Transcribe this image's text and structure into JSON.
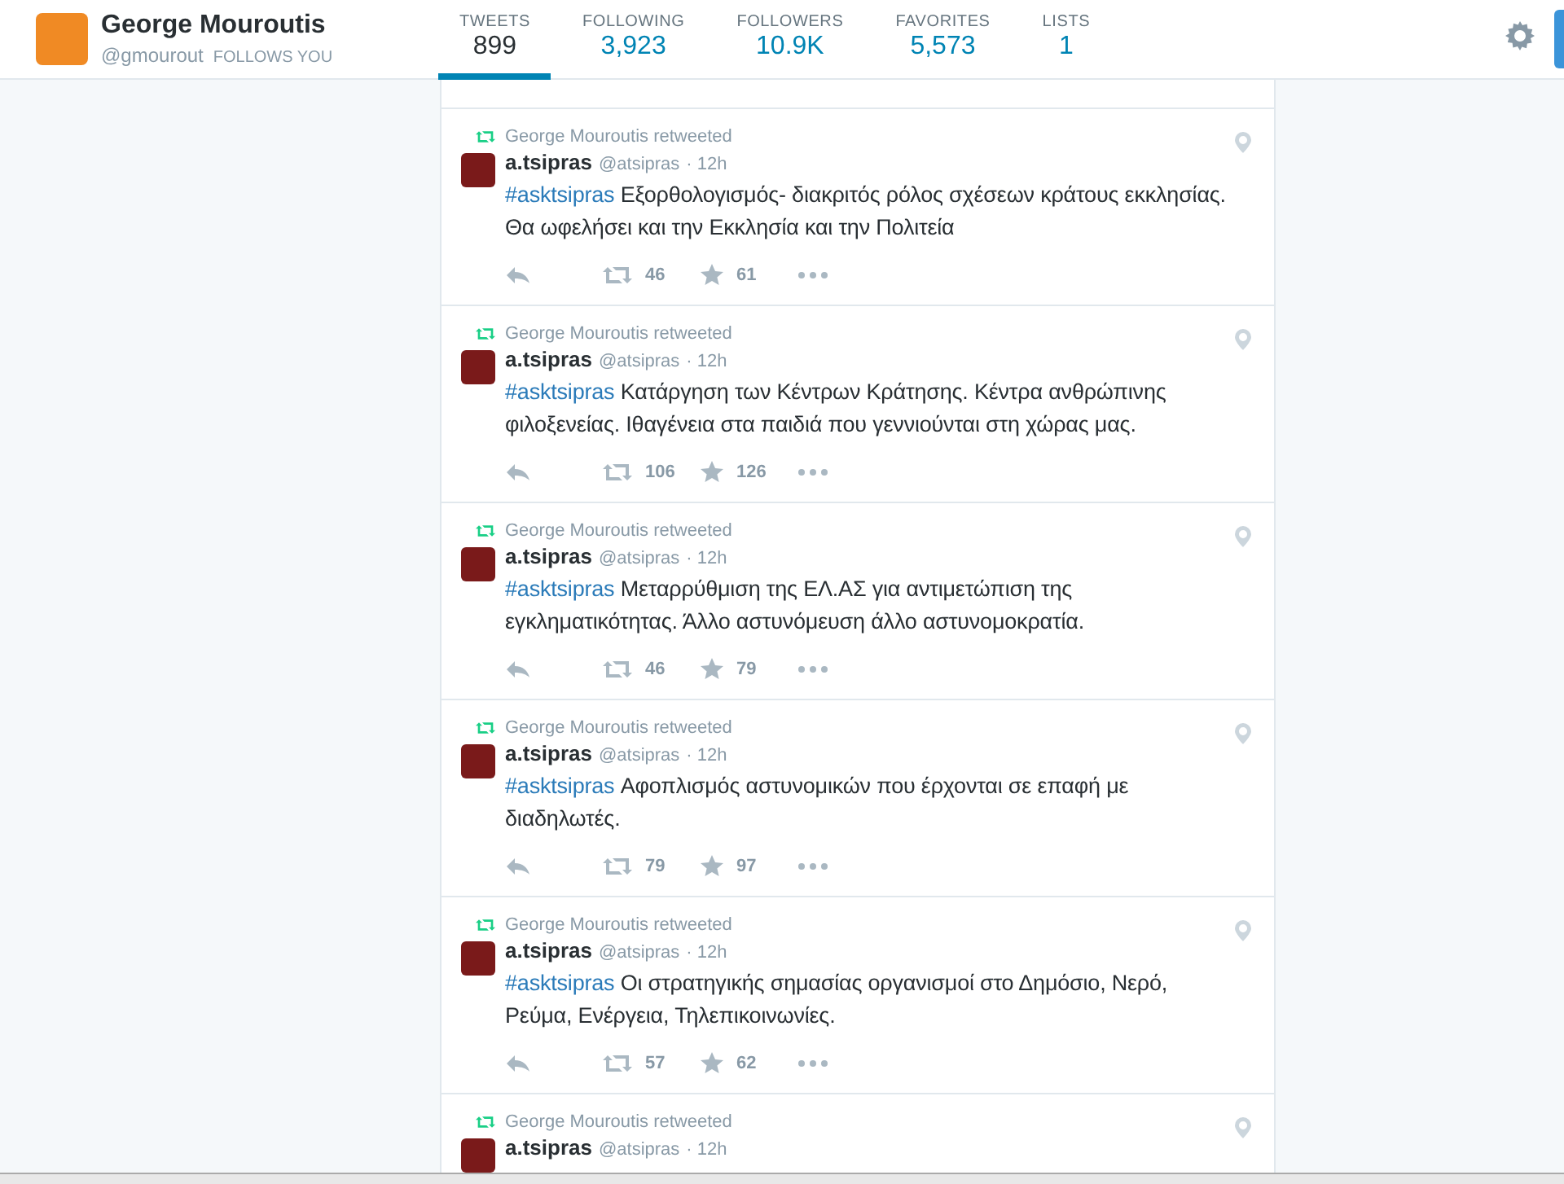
{
  "profile": {
    "name": "George Mouroutis",
    "handle": "@gmourout",
    "follows_you": "FOLLOWS YOU"
  },
  "stats": [
    {
      "label": "TWEETS",
      "value": "899",
      "selected": true
    },
    {
      "label": "FOLLOWING",
      "value": "3,923",
      "selected": false
    },
    {
      "label": "FOLLOWERS",
      "value": "10.9K",
      "selected": false
    },
    {
      "label": "FAVORITES",
      "value": "5,573",
      "selected": false
    },
    {
      "label": "LISTS",
      "value": "1",
      "selected": false
    }
  ],
  "tweets": [
    {
      "context": "George Mouroutis retweeted",
      "author": "a.tsipras",
      "handle": "@atsipras",
      "time": "· 12h",
      "hashtag": "#asktsipras",
      "text": "Εξορθολογισμός- διακριτός ρόλος σχέσεων κράτους εκκλησίας. Θα ωφελήσει και την Εκκλησία και την Πολιτεία",
      "retweets": "46",
      "favorites": "61"
    },
    {
      "context": "George Mouroutis retweeted",
      "author": "a.tsipras",
      "handle": "@atsipras",
      "time": "· 12h",
      "hashtag": "#asktsipras",
      "text": "Κατάργηση των Κέντρων Κράτησης. Κέντρα ανθρώπινης φιλοξενείας. Ιθαγένεια στα παιδιά που γεννιούνται στη χώρας μας.",
      "retweets": "106",
      "favorites": "126"
    },
    {
      "context": "George Mouroutis retweeted",
      "author": "a.tsipras",
      "handle": "@atsipras",
      "time": "· 12h",
      "hashtag": "#asktsipras",
      "text": "Μεταρρύθμιση της ΕΛ.ΑΣ για αντιμετώπιση της εγκληματικότητας. Άλλο αστυνόμευση άλλο αστυνομοκρατία.",
      "retweets": "46",
      "favorites": "79"
    },
    {
      "context": "George Mouroutis retweeted",
      "author": "a.tsipras",
      "handle": "@atsipras",
      "time": "· 12h",
      "hashtag": "#asktsipras",
      "text": "Αφοπλισμός αστυνομικών που έρχονται σε επαφή με διαδηλωτές.",
      "retweets": "79",
      "favorites": "97"
    },
    {
      "context": "George Mouroutis retweeted",
      "author": "a.tsipras",
      "handle": "@atsipras",
      "time": "· 12h",
      "hashtag": "#asktsipras",
      "text": "Οι στρατηγικής σημασίας οργανισμοί στο Δημόσιο, Νερό, Ρεύμα, Ενέργεια, Τηλεπικοινωνίες.",
      "retweets": "57",
      "favorites": "62"
    },
    {
      "context": "George Mouroutis retweeted",
      "author": "a.tsipras",
      "handle": "@atsipras",
      "time": "· 12h"
    }
  ]
}
